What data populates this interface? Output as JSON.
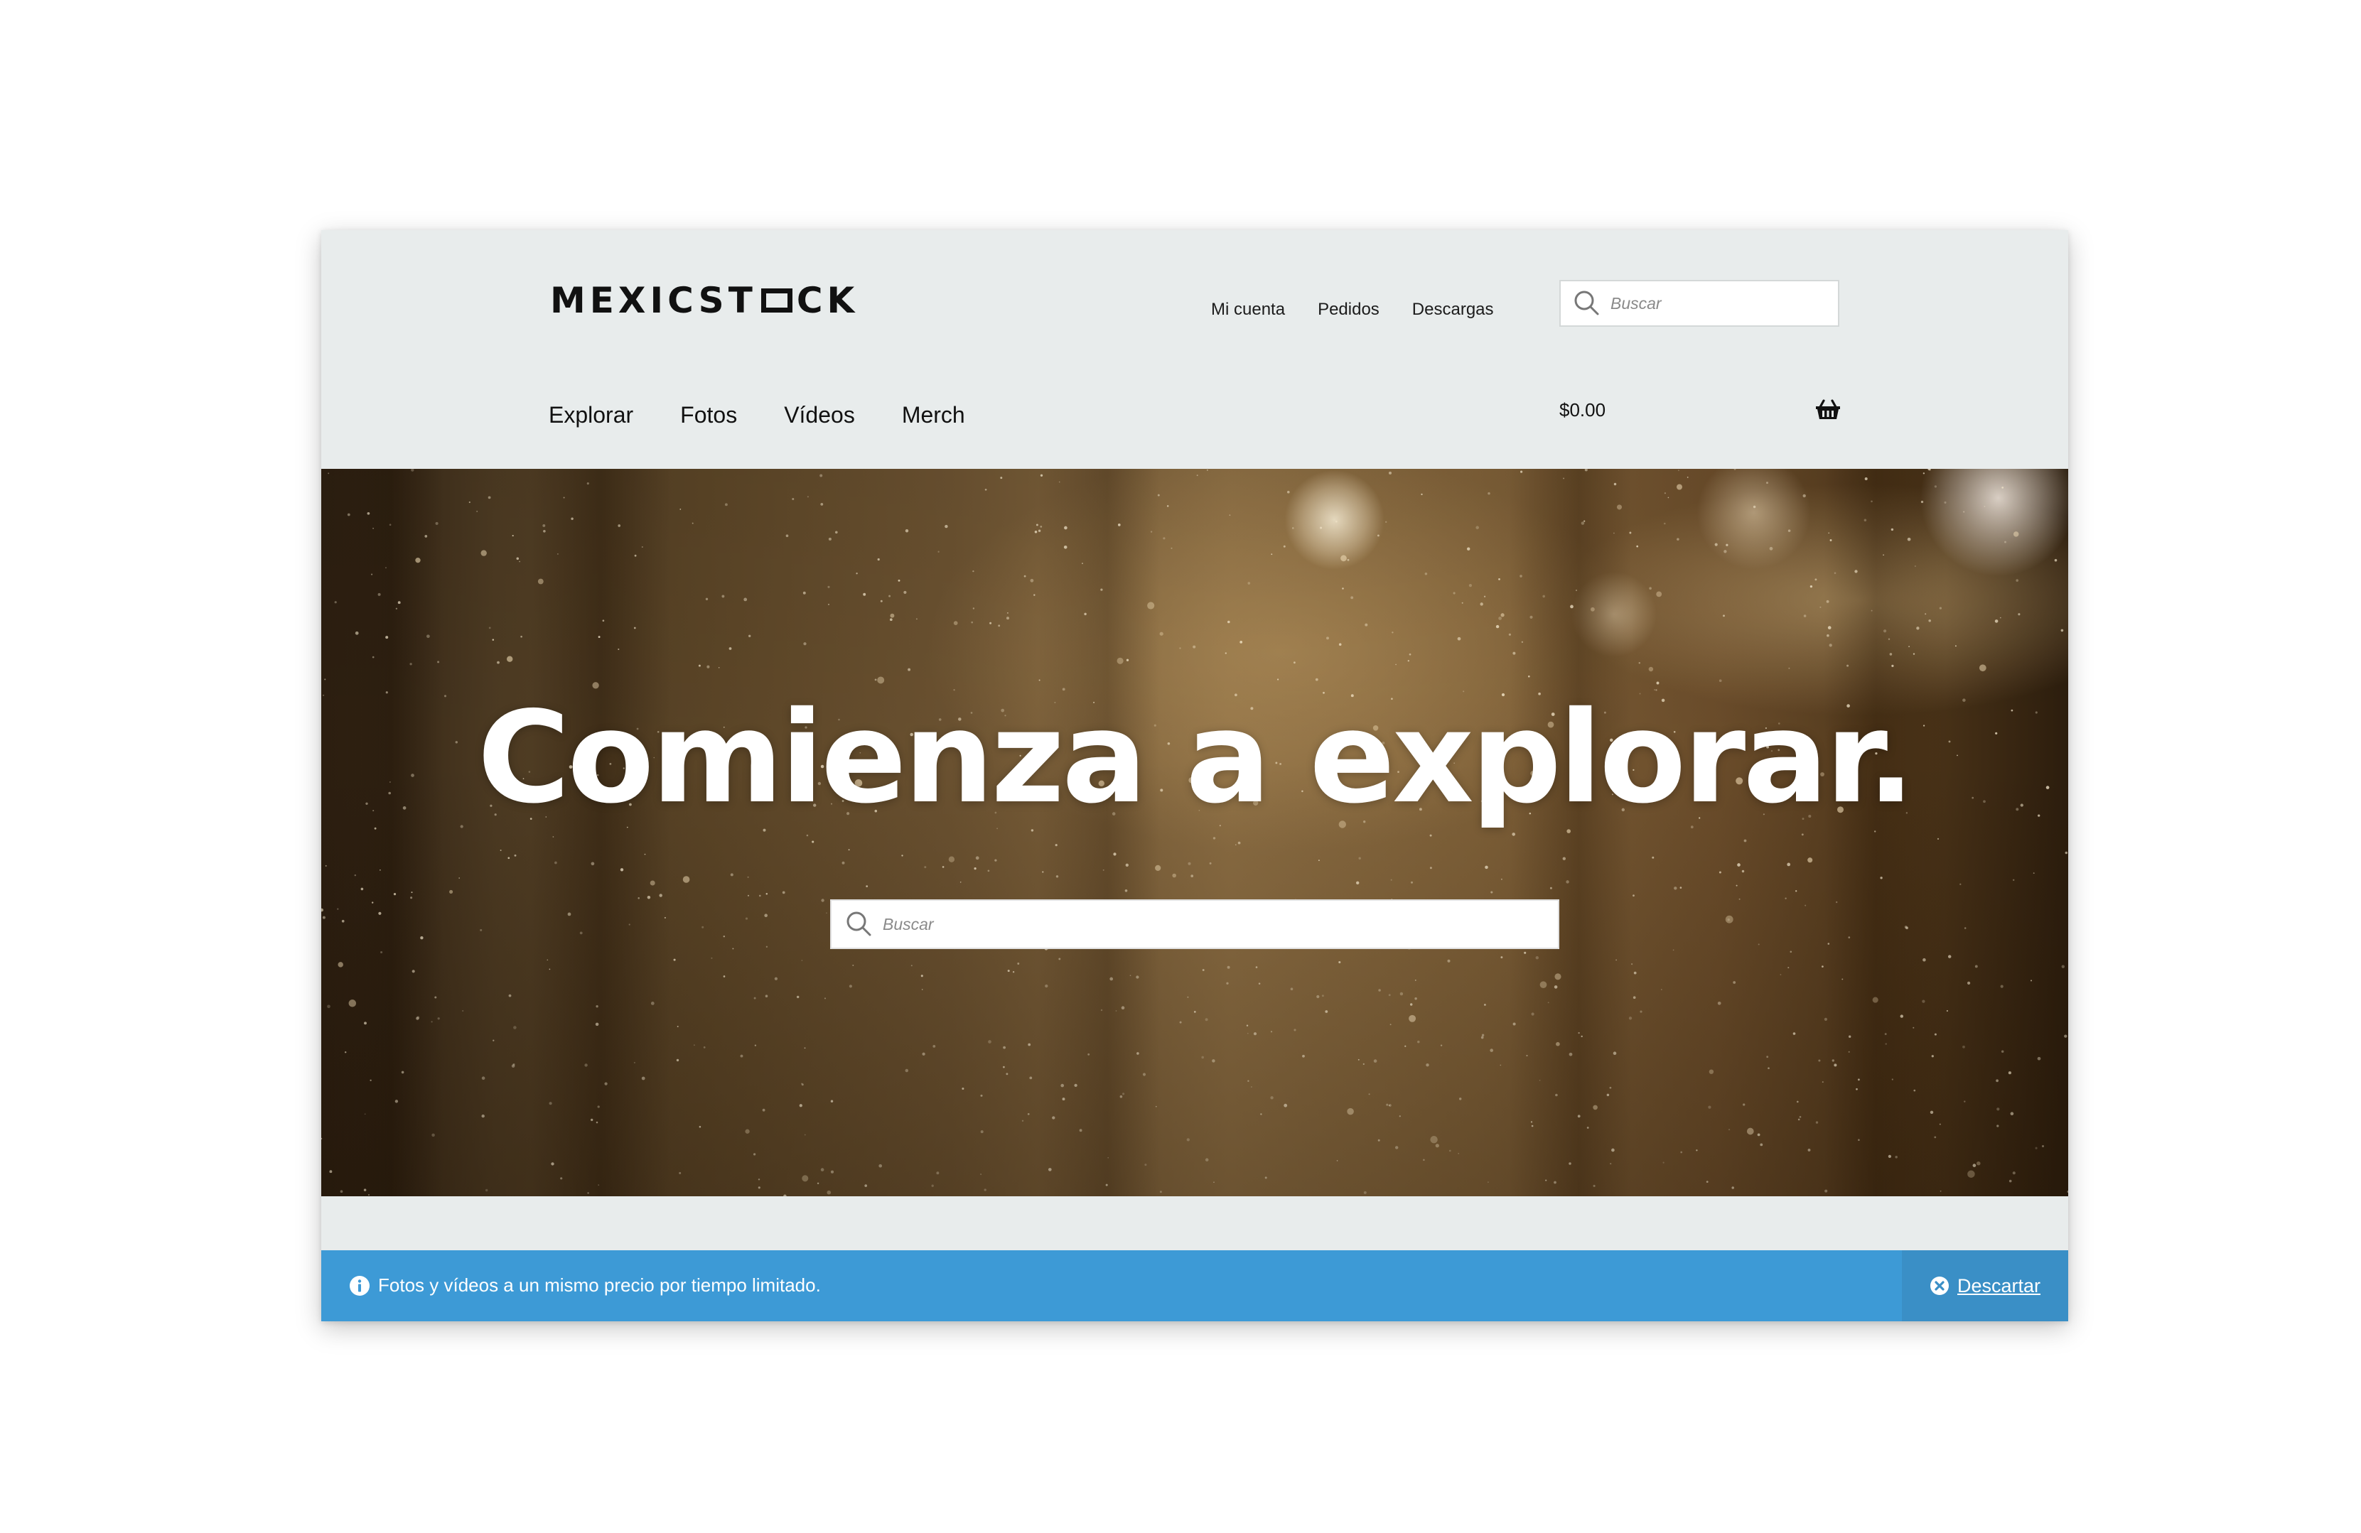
{
  "brand": {
    "logo_part1": "MEXICST",
    "logo_part2": "CK"
  },
  "top_links": {
    "account": "Mi cuenta",
    "orders": "Pedidos",
    "downloads": "Descargas"
  },
  "header_search": {
    "placeholder": "Buscar"
  },
  "main_nav": {
    "items": [
      {
        "label": "Explorar"
      },
      {
        "label": "Fotos"
      },
      {
        "label": "Vídeos"
      },
      {
        "label": "Merch"
      }
    ]
  },
  "cart": {
    "total": "$0.00",
    "icon": "basket-icon"
  },
  "hero": {
    "title": "Comienza a explorar.",
    "search_placeholder": "Buscar"
  },
  "notice": {
    "text": "Fotos y vídeos a un mismo precio por tiempo limitado.",
    "dismiss_label": "Descartar",
    "background": "#3d9ad6"
  }
}
